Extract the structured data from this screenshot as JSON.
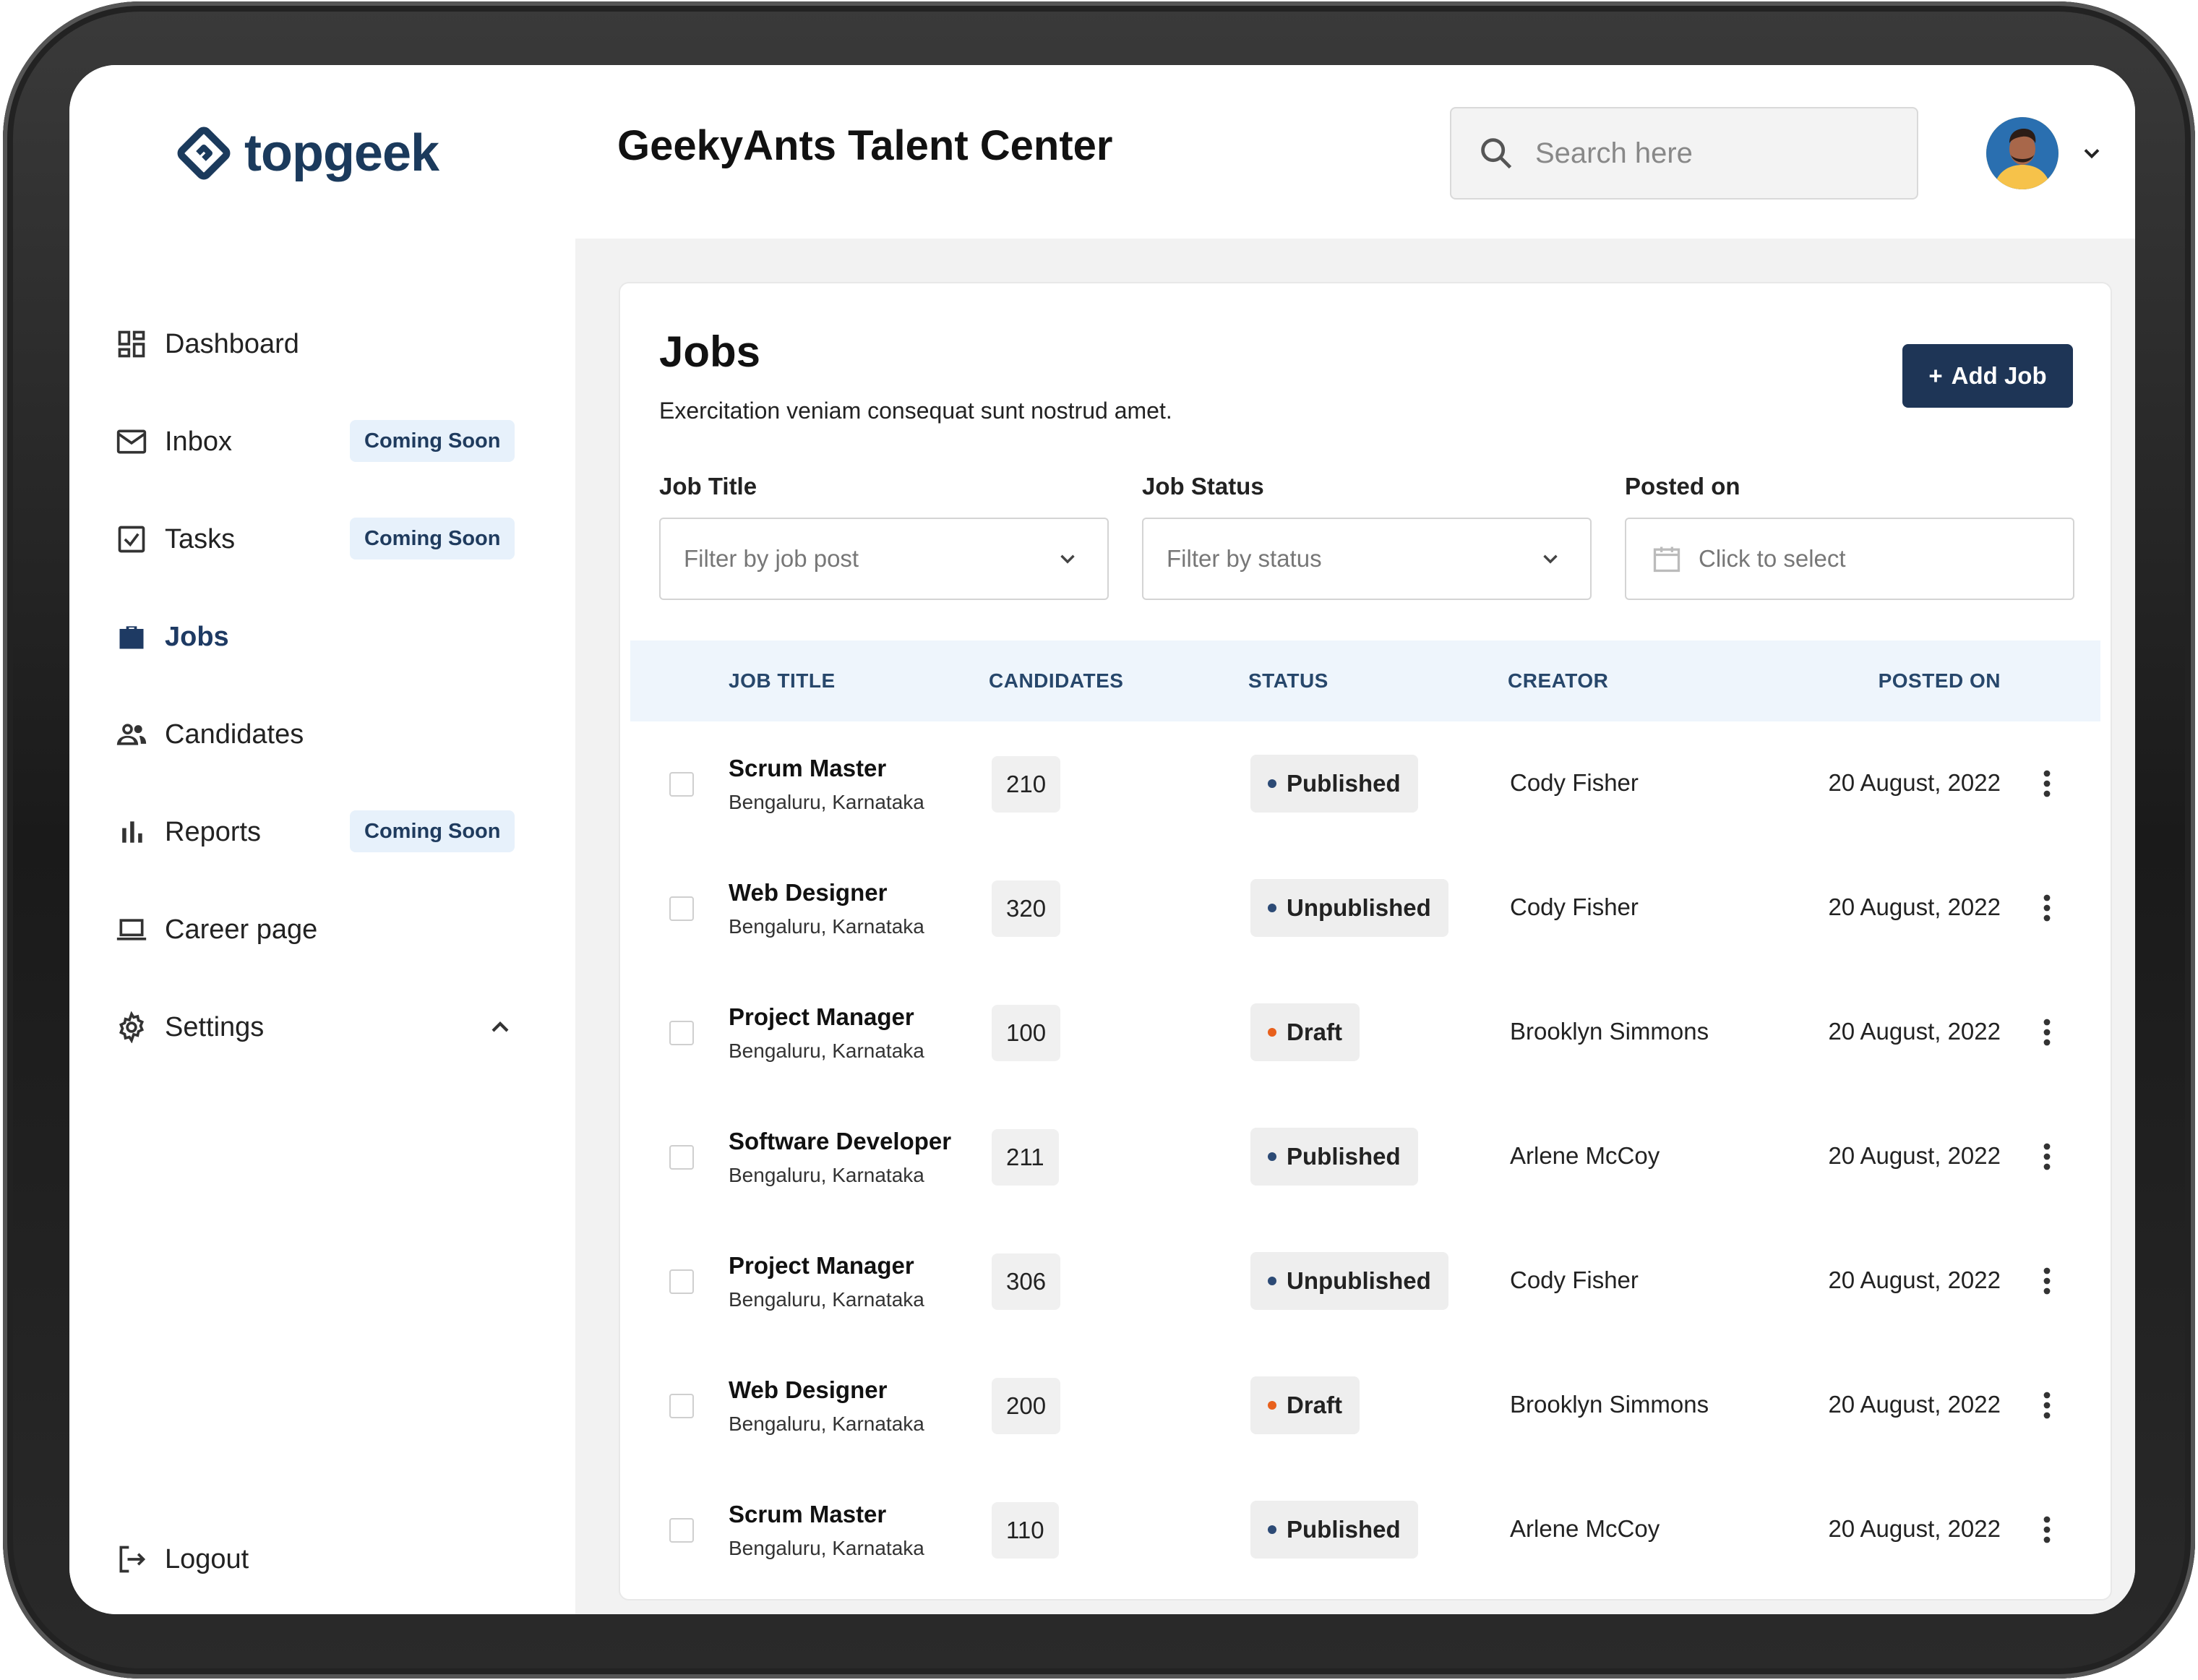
{
  "brand": {
    "name": "topgeek",
    "color": "#1b3a5c"
  },
  "colors": {
    "accent": "#1e3556",
    "active_nav": "#1e3a63",
    "dot_blue": "#2c4a75",
    "dot_orange": "#e8601c",
    "badge_bg": "#e7f1fb"
  },
  "sidebar": {
    "items": [
      {
        "label": "Dashboard",
        "icon": "dashboard-icon"
      },
      {
        "label": "Inbox",
        "icon": "mail-icon",
        "badge": "Coming Soon"
      },
      {
        "label": "Tasks",
        "icon": "checkbox-icon",
        "badge": "Coming Soon"
      },
      {
        "label": "Jobs",
        "icon": "briefcase-icon",
        "active": true
      },
      {
        "label": "Candidates",
        "icon": "people-icon"
      },
      {
        "label": "Reports",
        "icon": "bar-chart-icon",
        "badge": "Coming Soon"
      },
      {
        "label": "Career page",
        "icon": "laptop-icon"
      },
      {
        "label": "Settings",
        "icon": "gear-icon",
        "expanded": true
      }
    ],
    "logout": {
      "label": "Logout",
      "icon": "logout-icon"
    }
  },
  "header": {
    "title": "GeekyAnts Talent Center",
    "search_placeholder": "Search here"
  },
  "jobs": {
    "title": "Jobs",
    "subtitle": "Exercitation veniam consequat sunt nostrud amet.",
    "add_button": "Add Job",
    "add_button_icon": "+",
    "filters": [
      {
        "label": "Job Title",
        "placeholder": "Filter by job post"
      },
      {
        "label": "Job Status",
        "placeholder": "Filter by status"
      },
      {
        "label": "Posted on",
        "placeholder": "Click to select"
      }
    ],
    "columns": [
      "JOB TITLE",
      "CANDIDATES",
      "STATUS",
      "CREATOR",
      "POSTED ON"
    ],
    "rows": [
      {
        "title": "Scrum Master",
        "location": "Bengaluru, Karnataka",
        "candidates": "210",
        "status": "Published",
        "status_color": "#2c4a75",
        "creator": "Cody Fisher",
        "posted": "20 August, 2022"
      },
      {
        "title": "Web Designer",
        "location": "Bengaluru, Karnataka",
        "candidates": "320",
        "status": "Unpublished",
        "status_color": "#2c4a75",
        "creator": "Cody Fisher",
        "posted": "20 August, 2022"
      },
      {
        "title": "Project Manager",
        "location": "Bengaluru, Karnataka",
        "candidates": "100",
        "status": "Draft",
        "status_color": "#e8601c",
        "creator": "Brooklyn Simmons",
        "posted": "20 August, 2022"
      },
      {
        "title": "Software Developer",
        "location": "Bengaluru, Karnataka",
        "candidates": "211",
        "status": "Published",
        "status_color": "#2c4a75",
        "creator": "Arlene McCoy",
        "posted": "20 August, 2022"
      },
      {
        "title": "Project Manager",
        "location": "Bengaluru, Karnataka",
        "candidates": "306",
        "status": "Unpublished",
        "status_color": "#2c4a75",
        "creator": "Cody Fisher",
        "posted": "20 August, 2022"
      },
      {
        "title": "Web Designer",
        "location": "Bengaluru, Karnataka",
        "candidates": "200",
        "status": "Draft",
        "status_color": "#e8601c",
        "creator": "Brooklyn Simmons",
        "posted": "20 August, 2022"
      },
      {
        "title": "Scrum Master",
        "location": "Bengaluru, Karnataka",
        "candidates": "110",
        "status": "Published",
        "status_color": "#2c4a75",
        "creator": "Arlene McCoy",
        "posted": "20 August, 2022"
      }
    ]
  }
}
